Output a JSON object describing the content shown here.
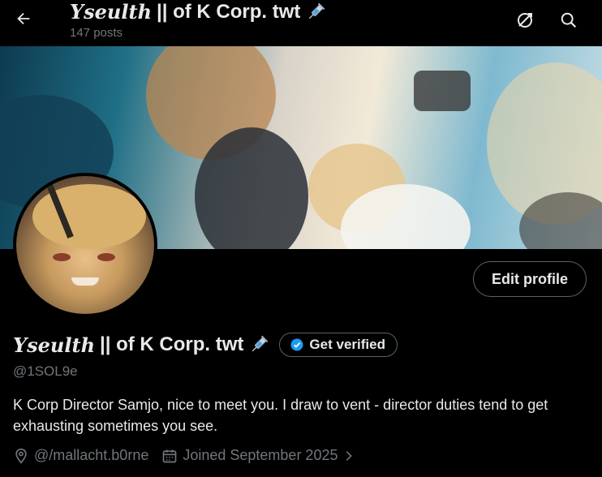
{
  "header": {
    "name_fancy": "Yseulth",
    "name_rest": "|| of K Corp. twt",
    "posts": "147 posts"
  },
  "icons": {
    "back": "back-arrow-icon",
    "stats": "stats-icon",
    "search": "search-icon",
    "syringe": "syringe-emoji",
    "verified": "verified-badge-icon",
    "location": "location-icon",
    "calendar": "calendar-icon",
    "chevron": "chevron-right-icon"
  },
  "profile": {
    "name_fancy": "Yseulth",
    "name_rest": "|| of K Corp. twt",
    "handle": "@1SOL9e",
    "bio": "K Corp Director Samjo, nice to meet you. I draw to vent - director duties tend to get exhausting sometimes you see.",
    "location": "@/mallacht.b0rne",
    "joined": "Joined September 2025"
  },
  "buttons": {
    "edit_profile": "Edit profile",
    "get_verified": "Get verified"
  },
  "colors": {
    "background": "#000000",
    "text": "#e7e9ea",
    "muted": "#71767b",
    "border": "#536471",
    "verified_blue": "#1d9bf0"
  }
}
